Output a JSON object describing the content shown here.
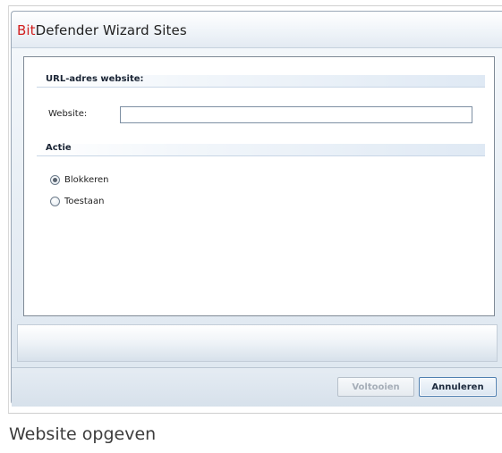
{
  "window": {
    "title_brand": "Bit",
    "title_rest": "Defender Wizard Sites"
  },
  "url_section": {
    "title": "URL-adres website:",
    "website_label": "Website:",
    "website_value": "",
    "website_placeholder": ""
  },
  "action_section": {
    "title": "Actie",
    "options": [
      {
        "label": "Blokkeren",
        "selected": true
      },
      {
        "label": "Toestaan",
        "selected": false
      }
    ]
  },
  "buttons": {
    "finish_label": "Voltooien",
    "finish_enabled": false,
    "cancel_label": "Annuleren"
  },
  "caption": "Website opgeven",
  "colors": {
    "brand_red": "#d21f1f",
    "accent_blue": "#4f7fb0",
    "disabled_text": "#a6aeb8"
  }
}
